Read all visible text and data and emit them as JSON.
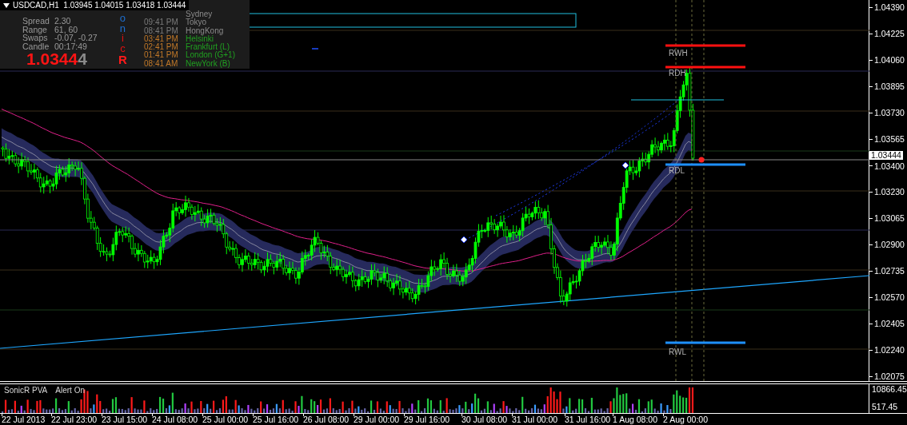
{
  "header": {
    "symbol_line": "USDCAD,H1  1.03945 1.04015 1.03418 1.03444"
  },
  "info_panel": {
    "stats": [
      {
        "label": "Spread",
        "value": "2.30"
      },
      {
        "label": "Range",
        "value": "61, 60"
      },
      {
        "label": "Swaps",
        "value": "-0.07, -0.27"
      },
      {
        "label": "Candle",
        "value": "00:17:49"
      }
    ],
    "price_main": "1.0344",
    "price_last_digit": "4",
    "logo_letters": [
      {
        "char": "o",
        "color": "#1e6fd0"
      },
      {
        "char": "n",
        "color": "#1e6fd0"
      },
      {
        "char": "i",
        "color": "#e01010"
      },
      {
        "char": "c",
        "color": "#e01010"
      },
      {
        "char": "R",
        "color": "#ff1a1a"
      }
    ],
    "sessions": [
      {
        "city": "Sydney",
        "open": false
      },
      {
        "time": "09:41 PM",
        "city": "Tokyo",
        "open": false
      },
      {
        "time": "08:41 PM",
        "city": "HongKong",
        "open": false
      },
      {
        "time": "03:41 PM",
        "city": "Helsinki",
        "open": true
      },
      {
        "time": "02:41 PM",
        "city": "Frankfurt  (L)",
        "open": true
      },
      {
        "time": "01:41 PM",
        "city": "London  (G+1)",
        "open": true
      },
      {
        "time": "08:41 AM",
        "city": "NewYork  (B)",
        "open": true
      }
    ]
  },
  "levels": [
    {
      "label": "RWH",
      "kind": "high"
    },
    {
      "label": "RDH",
      "kind": "high"
    },
    {
      "label": "RDL",
      "kind": "low"
    },
    {
      "label": "RWL",
      "kind": "low"
    }
  ],
  "price_axis": {
    "labels": [
      "1.04390",
      "1.04225",
      "1.04060",
      "1.03895",
      "1.03730",
      "1.03565",
      "1.03400",
      "1.03230",
      "1.03065",
      "1.02900",
      "1.02735",
      "1.02570",
      "1.02405",
      "1.02240",
      "1.02075"
    ],
    "current_price": "1.03444"
  },
  "indicator": {
    "name": "SonicR PVA",
    "status": "Alert On",
    "scale": [
      "10866.45",
      "517.45"
    ]
  },
  "time_axis": [
    "22 Jul 2013",
    "22 Jul 23:00",
    "23 Jul 15:00",
    "24 Jul 08:00",
    "25 Jul 00:00",
    "25 Jul 16:00",
    "26 Jul 08:00",
    "29 Jul 00:00",
    "29 Jul 16:00",
    "30 Jul 08:00",
    "31 Jul 00:00",
    "31 Jul 16:00",
    "1 Aug 08:00",
    "2 Aug 00:00"
  ]
}
